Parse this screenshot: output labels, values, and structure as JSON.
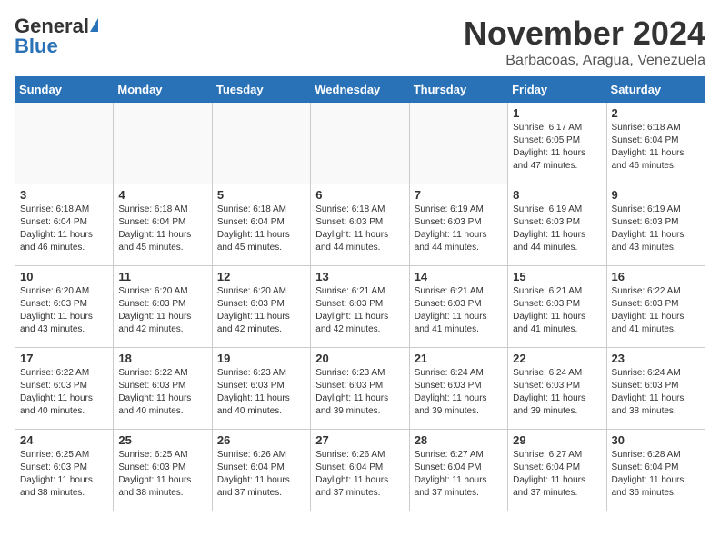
{
  "logo": {
    "general": "General",
    "blue": "Blue"
  },
  "title": "November 2024",
  "location": "Barbacoas, Aragua, Venezuela",
  "days_of_week": [
    "Sunday",
    "Monday",
    "Tuesday",
    "Wednesday",
    "Thursday",
    "Friday",
    "Saturday"
  ],
  "weeks": [
    [
      {
        "day": "",
        "info": ""
      },
      {
        "day": "",
        "info": ""
      },
      {
        "day": "",
        "info": ""
      },
      {
        "day": "",
        "info": ""
      },
      {
        "day": "",
        "info": ""
      },
      {
        "day": "1",
        "info": "Sunrise: 6:17 AM\nSunset: 6:05 PM\nDaylight: 11 hours and 47 minutes."
      },
      {
        "day": "2",
        "info": "Sunrise: 6:18 AM\nSunset: 6:04 PM\nDaylight: 11 hours and 46 minutes."
      }
    ],
    [
      {
        "day": "3",
        "info": "Sunrise: 6:18 AM\nSunset: 6:04 PM\nDaylight: 11 hours and 46 minutes."
      },
      {
        "day": "4",
        "info": "Sunrise: 6:18 AM\nSunset: 6:04 PM\nDaylight: 11 hours and 45 minutes."
      },
      {
        "day": "5",
        "info": "Sunrise: 6:18 AM\nSunset: 6:04 PM\nDaylight: 11 hours and 45 minutes."
      },
      {
        "day": "6",
        "info": "Sunrise: 6:18 AM\nSunset: 6:03 PM\nDaylight: 11 hours and 44 minutes."
      },
      {
        "day": "7",
        "info": "Sunrise: 6:19 AM\nSunset: 6:03 PM\nDaylight: 11 hours and 44 minutes."
      },
      {
        "day": "8",
        "info": "Sunrise: 6:19 AM\nSunset: 6:03 PM\nDaylight: 11 hours and 44 minutes."
      },
      {
        "day": "9",
        "info": "Sunrise: 6:19 AM\nSunset: 6:03 PM\nDaylight: 11 hours and 43 minutes."
      }
    ],
    [
      {
        "day": "10",
        "info": "Sunrise: 6:20 AM\nSunset: 6:03 PM\nDaylight: 11 hours and 43 minutes."
      },
      {
        "day": "11",
        "info": "Sunrise: 6:20 AM\nSunset: 6:03 PM\nDaylight: 11 hours and 42 minutes."
      },
      {
        "day": "12",
        "info": "Sunrise: 6:20 AM\nSunset: 6:03 PM\nDaylight: 11 hours and 42 minutes."
      },
      {
        "day": "13",
        "info": "Sunrise: 6:21 AM\nSunset: 6:03 PM\nDaylight: 11 hours and 42 minutes."
      },
      {
        "day": "14",
        "info": "Sunrise: 6:21 AM\nSunset: 6:03 PM\nDaylight: 11 hours and 41 minutes."
      },
      {
        "day": "15",
        "info": "Sunrise: 6:21 AM\nSunset: 6:03 PM\nDaylight: 11 hours and 41 minutes."
      },
      {
        "day": "16",
        "info": "Sunrise: 6:22 AM\nSunset: 6:03 PM\nDaylight: 11 hours and 41 minutes."
      }
    ],
    [
      {
        "day": "17",
        "info": "Sunrise: 6:22 AM\nSunset: 6:03 PM\nDaylight: 11 hours and 40 minutes."
      },
      {
        "day": "18",
        "info": "Sunrise: 6:22 AM\nSunset: 6:03 PM\nDaylight: 11 hours and 40 minutes."
      },
      {
        "day": "19",
        "info": "Sunrise: 6:23 AM\nSunset: 6:03 PM\nDaylight: 11 hours and 40 minutes."
      },
      {
        "day": "20",
        "info": "Sunrise: 6:23 AM\nSunset: 6:03 PM\nDaylight: 11 hours and 39 minutes."
      },
      {
        "day": "21",
        "info": "Sunrise: 6:24 AM\nSunset: 6:03 PM\nDaylight: 11 hours and 39 minutes."
      },
      {
        "day": "22",
        "info": "Sunrise: 6:24 AM\nSunset: 6:03 PM\nDaylight: 11 hours and 39 minutes."
      },
      {
        "day": "23",
        "info": "Sunrise: 6:24 AM\nSunset: 6:03 PM\nDaylight: 11 hours and 38 minutes."
      }
    ],
    [
      {
        "day": "24",
        "info": "Sunrise: 6:25 AM\nSunset: 6:03 PM\nDaylight: 11 hours and 38 minutes."
      },
      {
        "day": "25",
        "info": "Sunrise: 6:25 AM\nSunset: 6:03 PM\nDaylight: 11 hours and 38 minutes."
      },
      {
        "day": "26",
        "info": "Sunrise: 6:26 AM\nSunset: 6:04 PM\nDaylight: 11 hours and 37 minutes."
      },
      {
        "day": "27",
        "info": "Sunrise: 6:26 AM\nSunset: 6:04 PM\nDaylight: 11 hours and 37 minutes."
      },
      {
        "day": "28",
        "info": "Sunrise: 6:27 AM\nSunset: 6:04 PM\nDaylight: 11 hours and 37 minutes."
      },
      {
        "day": "29",
        "info": "Sunrise: 6:27 AM\nSunset: 6:04 PM\nDaylight: 11 hours and 37 minutes."
      },
      {
        "day": "30",
        "info": "Sunrise: 6:28 AM\nSunset: 6:04 PM\nDaylight: 11 hours and 36 minutes."
      }
    ]
  ]
}
